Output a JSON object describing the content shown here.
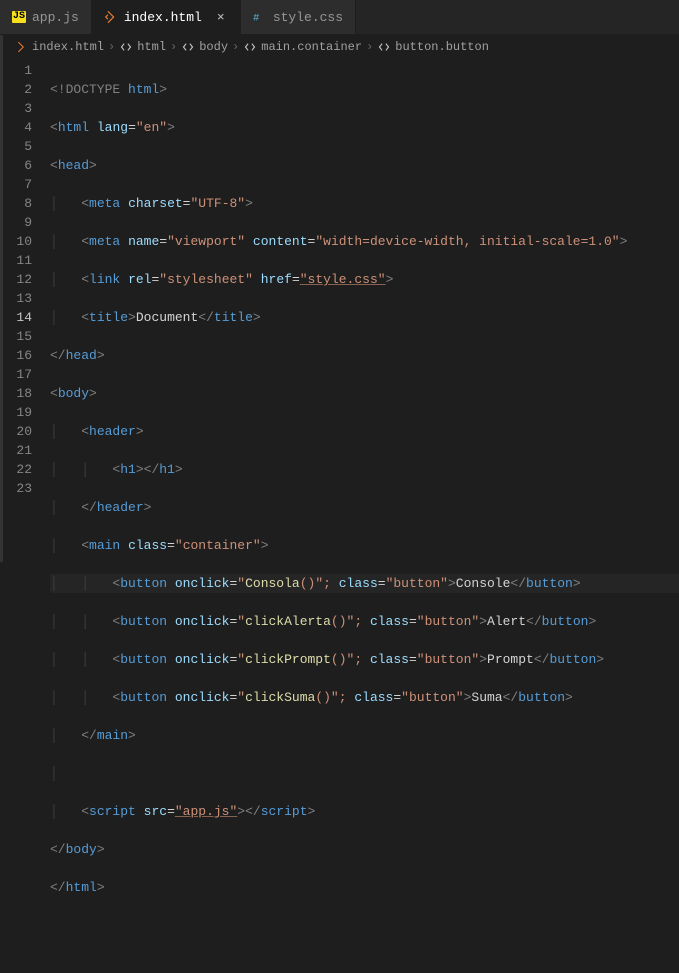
{
  "tabs": [
    {
      "label": "app.js",
      "iconName": "js-icon",
      "active": false
    },
    {
      "label": "index.html",
      "iconName": "html-icon",
      "active": true
    },
    {
      "label": "style.css",
      "iconName": "css-icon",
      "active": false
    }
  ],
  "breadcrumbs": [
    {
      "label": "index.html",
      "iconName": "html-icon"
    },
    {
      "label": "html",
      "iconName": "code-tag-icon"
    },
    {
      "label": "body",
      "iconName": "code-tag-icon"
    },
    {
      "label": "main.container",
      "iconName": "code-tag-icon"
    },
    {
      "label": "button.button",
      "iconName": "code-tag-icon"
    }
  ],
  "activeLine": 14,
  "lineCount": 23,
  "code": {
    "l1": {
      "doctype": "<!DOCTYPE ",
      "tag": "html",
      "close": ">"
    },
    "l2": {
      "open": "<",
      "tag": "html",
      "sp": " ",
      "attr": "lang",
      "eq": "=",
      "val": "\"en\"",
      "close": ">"
    },
    "l3": {
      "open": "<",
      "tag": "head",
      "close": ">"
    },
    "l4": {
      "open": "<",
      "tag": "meta",
      "sp": " ",
      "attr": "charset",
      "eq": "=",
      "val": "\"UTF-8\"",
      "close": ">"
    },
    "l5": {
      "open": "<",
      "tag": "meta",
      "sp": " ",
      "a1": "name",
      "eq1": "=",
      "v1": "\"viewport\"",
      "sp2": " ",
      "a2": "content",
      "eq2": "=",
      "v2": "\"width=device-width, initial-scale=1.0\"",
      "close": ">"
    },
    "l6": {
      "open": "<",
      "tag": "link",
      "sp": " ",
      "a1": "rel",
      "eq1": "=",
      "v1": "\"stylesheet\"",
      "sp2": " ",
      "a2": "href",
      "eq2": "=",
      "v2": "\"style.css\"",
      "close": ">"
    },
    "l7": {
      "open": "<",
      "tag": "title",
      "mid": ">",
      "text": "Document",
      "copen": "</",
      "ctag": "title",
      "cclose": ">"
    },
    "l8": {
      "open": "</",
      "tag": "head",
      "close": ">"
    },
    "l9": {
      "open": "<",
      "tag": "body",
      "close": ">"
    },
    "l10": {
      "open": "<",
      "tag": "header",
      "close": ">"
    },
    "l11": {
      "open": "<",
      "tag": "h1",
      "mid": "></",
      "ctag": "h1",
      "close": ">"
    },
    "l12": {
      "open": "</",
      "tag": "header",
      "close": ">"
    },
    "l13": {
      "open": "<",
      "tag": "main",
      "sp": " ",
      "attr": "class",
      "eq": "=",
      "val": "\"container\"",
      "close": ">"
    },
    "l14": {
      "open": "<",
      "tag": "button",
      "sp": " ",
      "attr": "onclick",
      "eq": "=",
      "q1": "\"",
      "fn": "Consola",
      "paren": "()",
      "vrest": "\";",
      "sp2": " ",
      "a2": "class",
      "eq2": "=",
      "v2": "\"button\"",
      "mid": ">",
      "text": "Console",
      "copen": "</",
      "ctag": "button",
      "cclose": ">"
    },
    "l15": {
      "open": "<",
      "tag": "button",
      "sp": " ",
      "attr": "onclick",
      "eq": "=",
      "q1": "\"",
      "fn": "clickAlerta",
      "paren": "()",
      "vrest": "\";",
      "sp2": " ",
      "a2": "class",
      "eq2": "=",
      "v2": "\"button\"",
      "mid": ">",
      "text": "Alert",
      "copen": "</",
      "ctag": "button",
      "cclose": ">"
    },
    "l16": {
      "open": "<",
      "tag": "button",
      "sp": " ",
      "attr": "onclick",
      "eq": "=",
      "q1": "\"",
      "fn": "clickPrompt",
      "paren": "()",
      "vrest": "\";",
      "sp2": " ",
      "a2": "class",
      "eq2": "=",
      "v2": "\"button\"",
      "mid": ">",
      "text": "Prompt",
      "copen": "</",
      "ctag": "button",
      "cclose": ">"
    },
    "l17": {
      "open": "<",
      "tag": "button",
      "sp": " ",
      "attr": "onclick",
      "eq": "=",
      "q1": "\"",
      "fn": "clickSuma",
      "paren": "()",
      "vrest": "\";",
      "sp2": " ",
      "a2": "class",
      "eq2": "=",
      "v2": "\"button\"",
      "mid": ">",
      "text": "Suma",
      "copen": "</",
      "ctag": "button",
      "cclose": ">"
    },
    "l18": {
      "open": "</",
      "tag": "main",
      "close": ">"
    },
    "l19": {
      "blank": ""
    },
    "l20": {
      "open": "<",
      "tag": "script",
      "sp": " ",
      "attr": "src",
      "eq": "=",
      "val": "\"app.js\"",
      "mid": "></",
      "ctag": "script",
      "close": ">"
    },
    "l21": {
      "open": "</",
      "tag": "body",
      "close": ">"
    },
    "l22": {
      "open": "</",
      "tag": "html",
      "close": ">"
    }
  }
}
